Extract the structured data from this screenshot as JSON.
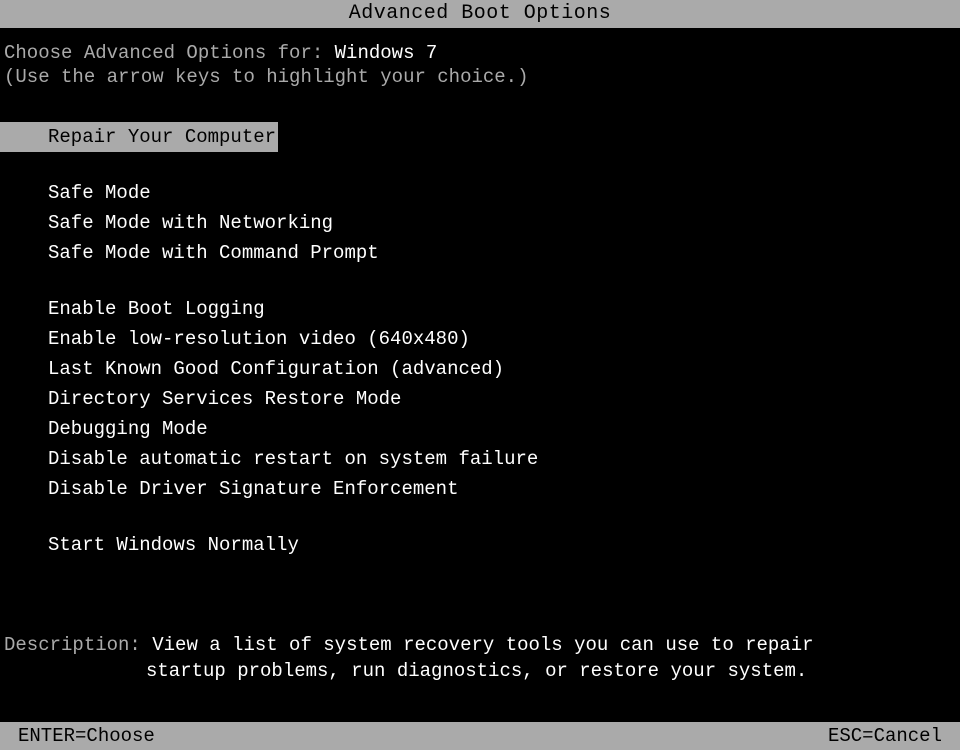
{
  "title": "Advanced Boot Options",
  "header": {
    "prefix": "Choose Advanced Options for: ",
    "os_name": "Windows 7",
    "instruction": "(Use the arrow keys to highlight your choice.)"
  },
  "menu": {
    "selected_index": 0,
    "groups": [
      [
        "Repair Your Computer"
      ],
      [
        "Safe Mode",
        "Safe Mode with Networking",
        "Safe Mode with Command Prompt"
      ],
      [
        "Enable Boot Logging",
        "Enable low-resolution video (640x480)",
        "Last Known Good Configuration (advanced)",
        "Directory Services Restore Mode",
        "Debugging Mode",
        "Disable automatic restart on system failure",
        "Disable Driver Signature Enforcement"
      ],
      [
        "Start Windows Normally"
      ]
    ]
  },
  "description": {
    "label": "Description: ",
    "line1": "View a list of system recovery tools you can use to repair",
    "line2": "startup problems, run diagnostics, or restore your system."
  },
  "footer": {
    "enter": "ENTER=Choose",
    "esc": "ESC=Cancel"
  }
}
